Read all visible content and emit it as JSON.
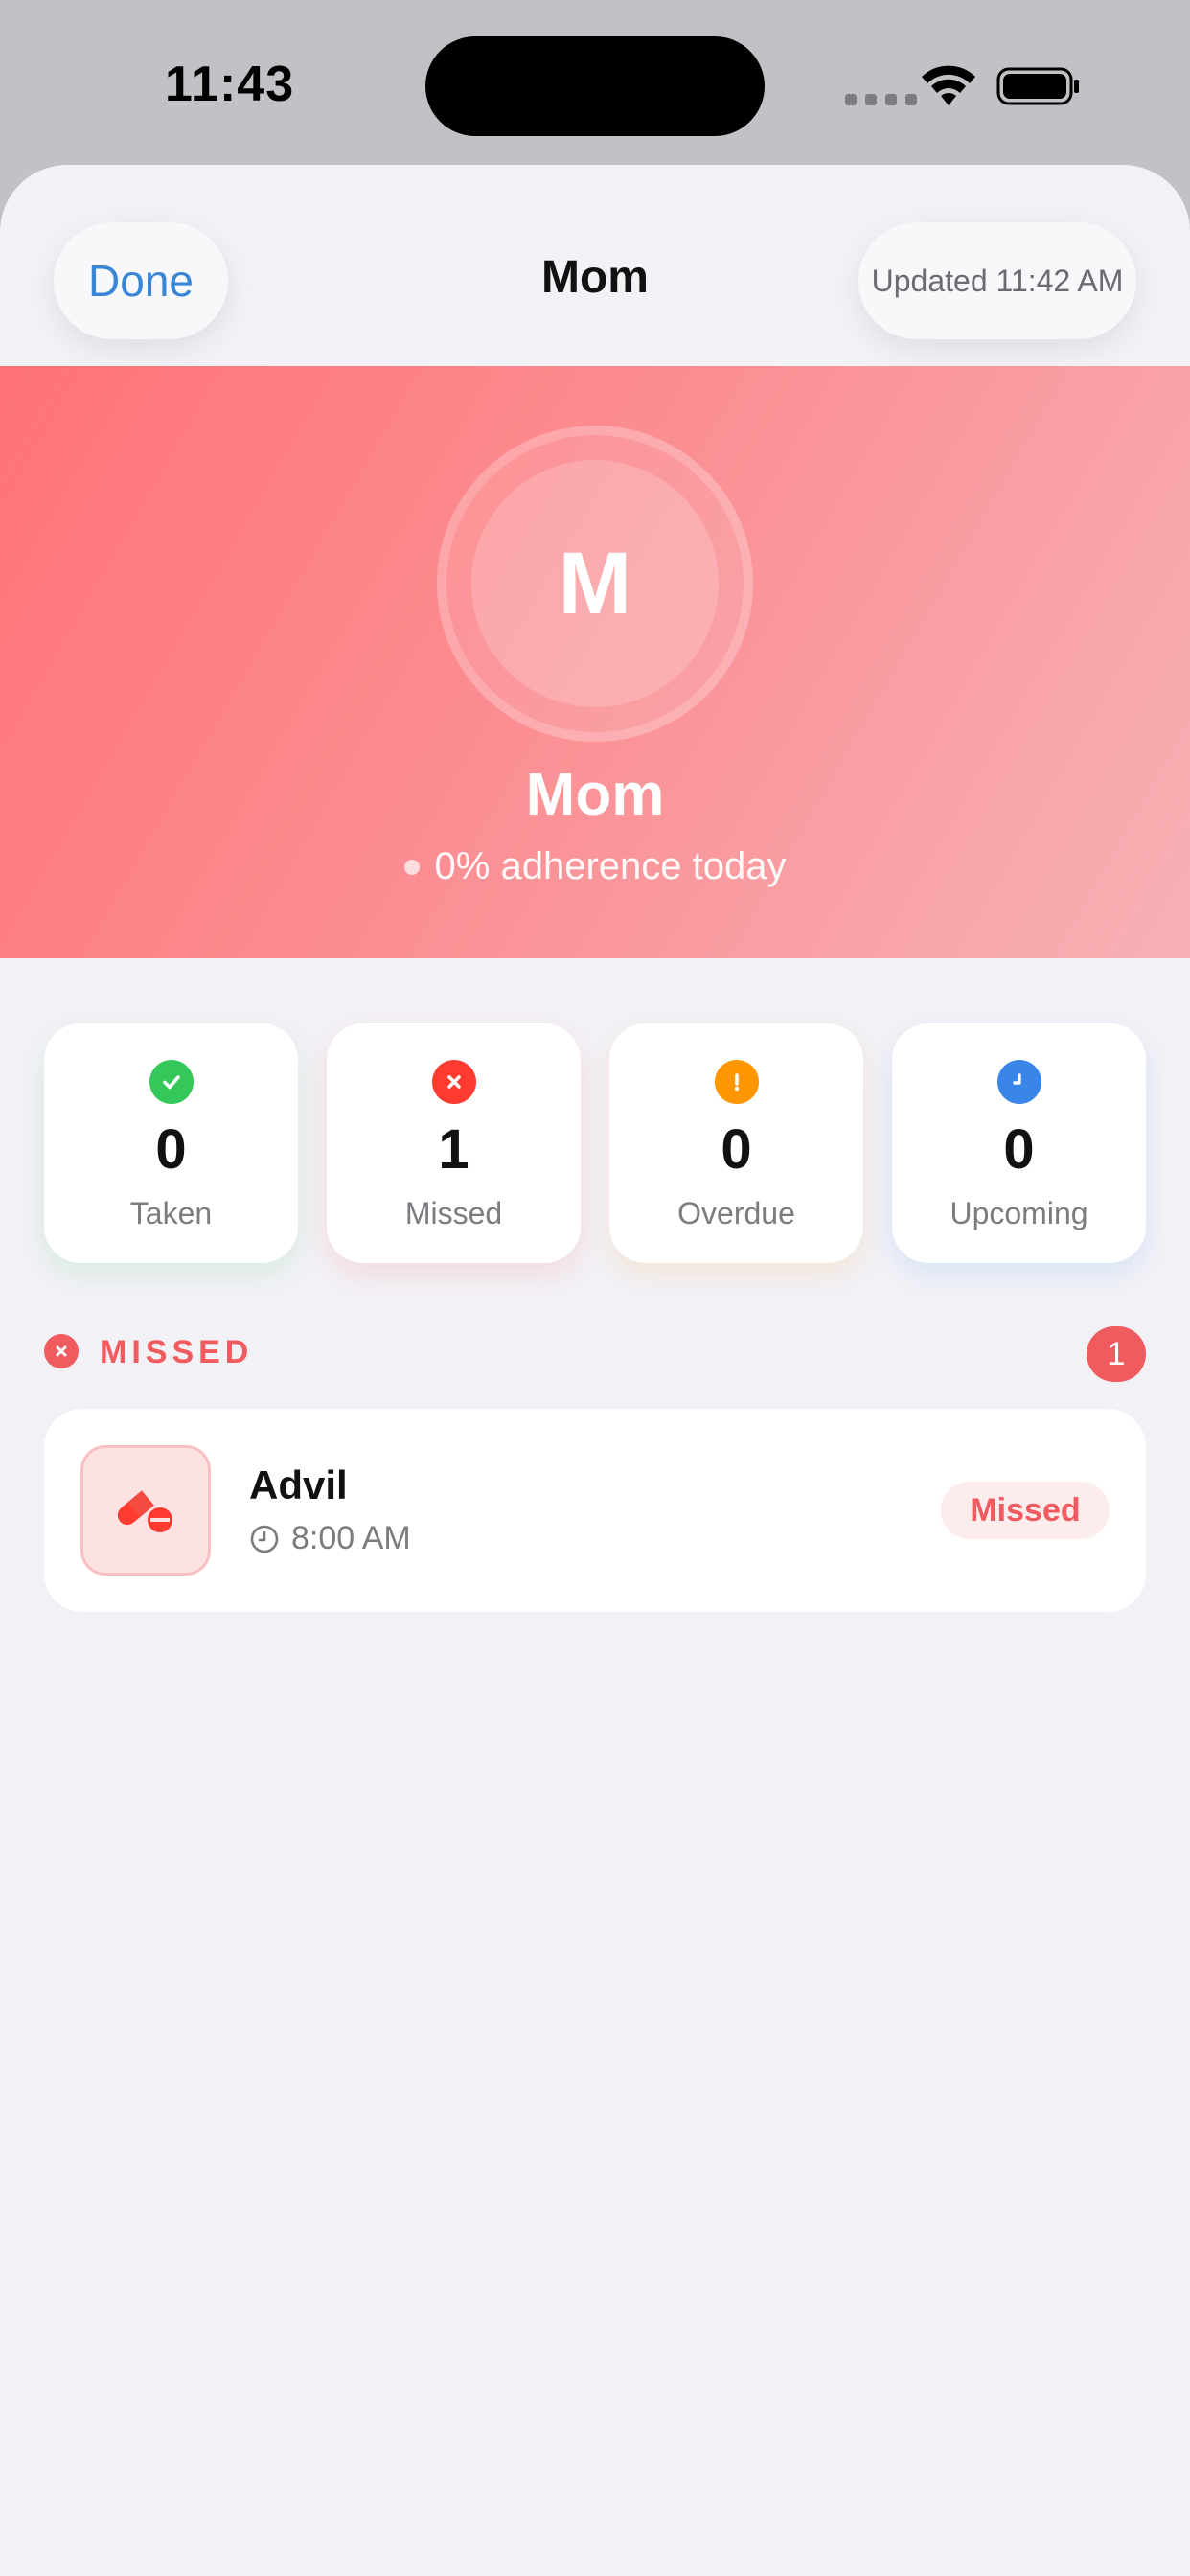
{
  "status_bar": {
    "time": "11:43"
  },
  "nav": {
    "done_label": "Done",
    "title": "Mom",
    "updated_label": "Updated 11:42 AM"
  },
  "profile": {
    "initial": "M",
    "name": "Mom",
    "adherence_text": "0% adherence today"
  },
  "stats": [
    {
      "value": "0",
      "label": "Taken",
      "icon": "checkmark-icon",
      "color": "#34c759"
    },
    {
      "value": "1",
      "label": "Missed",
      "icon": "x-icon",
      "color": "#ff3b30"
    },
    {
      "value": "0",
      "label": "Overdue",
      "icon": "exclamation-icon",
      "color": "#ff9500"
    },
    {
      "value": "0",
      "label": "Upcoming",
      "icon": "clock-icon",
      "color": "#3a86e8"
    }
  ],
  "missed_section": {
    "title": "MISSED",
    "count": "1"
  },
  "medications": [
    {
      "name": "Advil",
      "time": "8:00 AM",
      "status": "Missed",
      "icon": "pills-icon"
    }
  ],
  "colors": {
    "accent_red": "#ef5b5e",
    "link_blue": "#3a86d6",
    "background": "#f2f1f6"
  }
}
